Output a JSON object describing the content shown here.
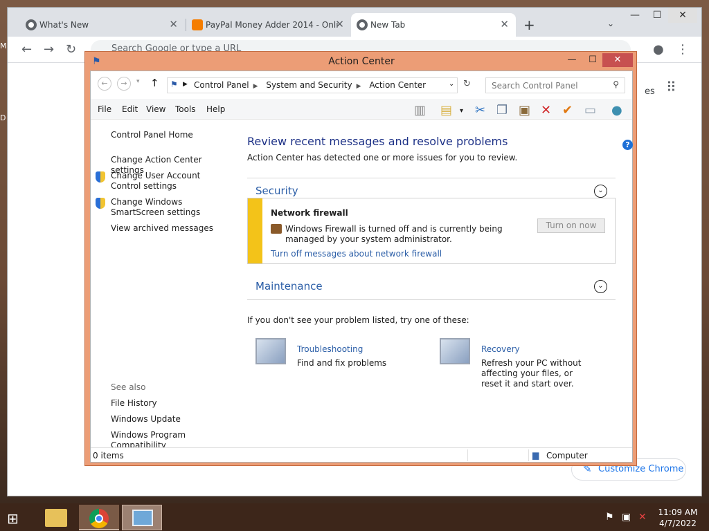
{
  "browser": {
    "tabs": [
      {
        "label": "What's New",
        "icon": "chrome-icon"
      },
      {
        "label": "PayPal Money Adder 2014 - Onli",
        "icon": "blogger-icon"
      },
      {
        "label": "New Tab",
        "icon": "chrome-icon"
      }
    ],
    "omnibox_placeholder": "Search Google or type a URL",
    "partial_text": "es",
    "customize_label": "Customize Chrome"
  },
  "window": {
    "title": "Action Center",
    "breadcrumb": [
      "Control Panel",
      "System and Security",
      "Action Center"
    ],
    "search_placeholder": "Search Control Panel",
    "menu": [
      "File",
      "Edit",
      "View",
      "Tools",
      "Help"
    ]
  },
  "left": {
    "home": "Control Panel Home",
    "links": [
      "Change Action Center settings",
      "Change User Account Control settings",
      "Change Windows SmartScreen settings",
      "View archived messages"
    ],
    "see_also_heading": "See also",
    "see_also": [
      "File History",
      "Windows Update",
      "Windows Program Compatibility Troubleshooter"
    ]
  },
  "main": {
    "heading": "Review recent messages and resolve problems",
    "subtitle": "Action Center has detected one or more issues for you to review.",
    "security_title": "Security",
    "alert": {
      "title": "Network firewall",
      "desc": "Windows Firewall is turned off and is currently being managed by your system administrator.",
      "link": "Turn off messages about network firewall",
      "button": "Turn on now"
    },
    "maintenance_title": "Maintenance",
    "try_text": "If you don't see your problem listed, try one of these:",
    "tools": [
      {
        "title": "Troubleshooting",
        "desc": "Find and fix problems"
      },
      {
        "title": "Recovery",
        "desc": "Refresh your PC without affecting your files, or reset it and start over."
      }
    ]
  },
  "status": {
    "items": "0 items",
    "location": "Computer"
  },
  "taskbar": {
    "time": "11:09 AM",
    "date": "4/7/2022"
  },
  "colors": {
    "titlebar": "#ec9d76",
    "link": "#2b5ea7",
    "alert_bar": "#f3c319",
    "taskbar": "#3d261a"
  }
}
